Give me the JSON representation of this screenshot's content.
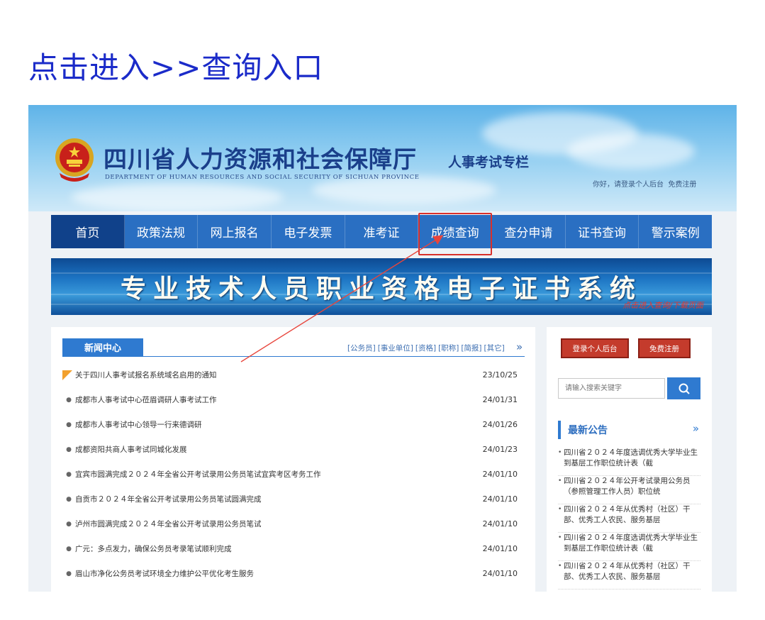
{
  "caption": "点击进入>>查询入口",
  "header": {
    "org_cn": "四川省人力资源和社会保障厅",
    "org_en": "DEPARTMENT OF HUMAN RESOURCES AND SOCIAL SECURITY OF SICHUAN PROVINCE",
    "column_title": "人事考试专栏",
    "greeting": "你好，请登录个人后台",
    "register_link": "免费注册"
  },
  "nav": {
    "items": [
      "首页",
      "政策法规",
      "网上报名",
      "电子发票",
      "准考证",
      "成绩查询",
      "查分申请",
      "证书查询",
      "警示案例"
    ],
    "active": "首页",
    "highlighted": "成绩查询"
  },
  "banner": {
    "title": "专业技术人员职业资格电子证书系统",
    "link": "点击进入查询/下载页面"
  },
  "news": {
    "tab": "新闻中心",
    "categories": [
      "[公务员]",
      "[事业单位]",
      "[资格]",
      "[职称]",
      "[简报]",
      "[其它]"
    ],
    "more": "»",
    "items": [
      {
        "title": "关于四川人事考试报名系统域名启用的通知",
        "date": "23/10/25"
      },
      {
        "title": "成都市人事考试中心莅眉调研人事考试工作",
        "date": "24/01/31"
      },
      {
        "title": "成都市人事考试中心领导一行来德调研",
        "date": "24/01/26"
      },
      {
        "title": "成都资阳共商人事考试同城化发展",
        "date": "24/01/23"
      },
      {
        "title": "宜宾市圆满完成２０２４年全省公开考试录用公务员笔试宜宾考区考务工作",
        "date": "24/01/10"
      },
      {
        "title": "自贡市２０２４年全省公开考试录用公务员笔试圆满完成",
        "date": "24/01/10"
      },
      {
        "title": "泸州市圆满完成２０２４年全省公开考试录用公务员笔试",
        "date": "24/01/10"
      },
      {
        "title": "广元：多点发力，确保公务员考录笔试顺利完成",
        "date": "24/01/10"
      },
      {
        "title": "眉山市净化公务员考试环境全力维护公平优化考生服务",
        "date": "24/01/10"
      }
    ]
  },
  "sidebar": {
    "login_button": "登录个人后台",
    "register_button": "免费注册",
    "search_placeholder": "请输入搜索关键字",
    "notice_title": "最新公告",
    "notice_more": "»",
    "notices": [
      "四川省２０２４年度选调优秀大学毕业生到基层工作职位统计表（截",
      "四川省２０２４年公开考试录用公务员（参照管理工作人员）职位统",
      "四川省２０２４年从优秀村（社区）干部、优秀工人农民、服务基层",
      "四川省２０２４年度选调优秀大学毕业生到基层工作职位统计表（截",
      "四川省２０２４年从优秀村（社区）干部、优秀工人农民、服务基层"
    ]
  },
  "colors": {
    "caption": "#1b2bc9",
    "nav_bg": "#2a6fc2",
    "nav_active": "#10418a",
    "accent_red": "#d9302b"
  }
}
